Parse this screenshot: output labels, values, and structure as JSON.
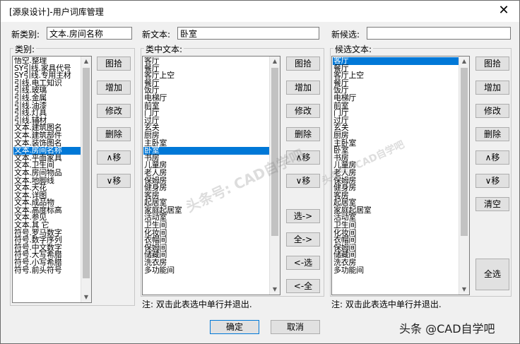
{
  "window": {
    "title": "[源泉设计]-用户词库管理"
  },
  "top": {
    "new_category_label": "新类别:",
    "new_category_value": "文本.房间名称",
    "new_text_label": "新文本:",
    "new_text_value": "卧室",
    "new_candidate_label": "新候选:",
    "new_candidate_value": ""
  },
  "category": {
    "title": "类别:",
    "items": [
      "悟空.整理",
      "SY引线.家具代号",
      "SY引线.专用主材",
      "引线.电工知识",
      "引线.玻璃",
      "引线.金属",
      "引线.油漆",
      "引线.灯具",
      "引线.辅材",
      "文本.建筑图名",
      "文本.建筑部件",
      "文本.装饰图名",
      "文本.房间名称",
      "文本.平面家具",
      "文本.卫生间",
      "文本.房间物品",
      "文本.地脚线",
      "文本.天花",
      "文本.详图",
      "文本.成品物",
      "文本.高度标高",
      "文本.参见",
      "文本.其    它",
      "符号.罗马数字",
      "符号.数字序列",
      "符号.中文数字",
      "符号.大写希腊",
      "符号.小写希腊",
      "符号.前头符号"
    ],
    "selected": "文本.房间名称",
    "buttons": [
      "图拾",
      "增加",
      "修改",
      "删除",
      "∧移",
      "∨移"
    ]
  },
  "text": {
    "title": "类中文本:",
    "items": [
      "客厅",
      "餐厅",
      "客厅上空",
      "餐厅",
      "饭厅",
      "电梯厅",
      "前室",
      "门厅",
      "过厅",
      "玄关",
      "厨房",
      "主卧室",
      "卧室",
      "书房",
      "儿童房",
      "老人房",
      "保姆房",
      "健身房",
      "客房",
      "起居室",
      "家庭起居室",
      "活动室",
      "卫生间",
      "化妆间",
      "衣帽间",
      "保姆间",
      "储藏间",
      "洗衣房",
      "多功能间"
    ],
    "selected": "卧室",
    "buttons": [
      "图拾",
      "增加",
      "修改",
      "删除",
      "∧移",
      "∨移"
    ],
    "transfer_buttons": [
      "选->",
      "全->",
      "<-选",
      "<-全"
    ],
    "note": "注: 双击此表选中单行并退出."
  },
  "candidate": {
    "title": "候选文本:",
    "items": [
      "客厅",
      "餐厅",
      "客厅上空",
      "餐厅",
      "饭厅",
      "电梯厅",
      "前室",
      "门厅",
      "过厅",
      "玄关",
      "厨房",
      "主卧室",
      "卧室",
      "书房",
      "儿童房",
      "老人房",
      "保姆房",
      "健身房",
      "客房",
      "起居室",
      "家庭起居室",
      "活动室",
      "卫生间",
      "化妆间",
      "衣帽间",
      "保姆间",
      "储藏间",
      "洗衣房",
      "多功能间"
    ],
    "selected": "客厅",
    "buttons": [
      "图拾",
      "增加",
      "修改",
      "删除",
      "∧移",
      "∨移",
      "清空"
    ],
    "select_all": "全选",
    "note": "注: 双击此表选中单行并退出."
  },
  "footer": {
    "ok": "确定",
    "cancel": "取消"
  },
  "overlay": {
    "watermark": "头条号: CAD自学吧",
    "watermark2": "头条号: CAD自学吧",
    "credit": "头条 @CAD自学吧"
  },
  "colors": {
    "selection": "#0078d7",
    "dialog_bg": "#f0f0f0"
  }
}
